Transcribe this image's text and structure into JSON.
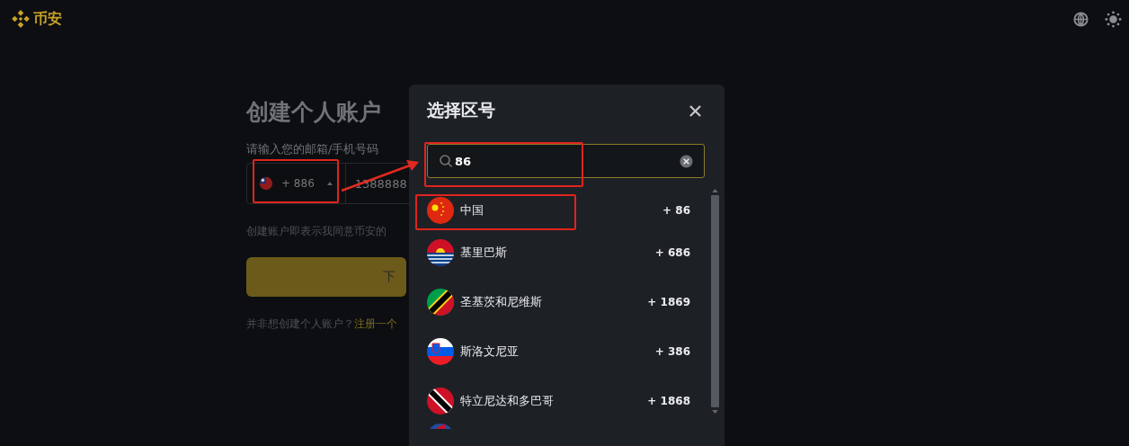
{
  "header": {
    "logo_text": "币安"
  },
  "form": {
    "title": "创建个人账户",
    "field_label": "请输入您的邮箱/手机号码",
    "country_code": "+ 886",
    "phone": "1388888",
    "terms": "创建账户即表示我同意币安的",
    "next_button": "下",
    "alt_prompt": "并非想创建个人账户？",
    "alt_link": "注册一个"
  },
  "dialog": {
    "title": "选择区号",
    "search": {
      "value": "86"
    },
    "countries": [
      {
        "name": "中国",
        "code": "+ 86"
      },
      {
        "name": "基里巴斯",
        "code": "+ 686"
      },
      {
        "name": "圣基茨和尼维斯",
        "code": "+ 1869"
      },
      {
        "name": "斯洛文尼亚",
        "code": "+ 386"
      },
      {
        "name": "特立尼达和多巴哥",
        "code": "+ 1868"
      }
    ]
  }
}
